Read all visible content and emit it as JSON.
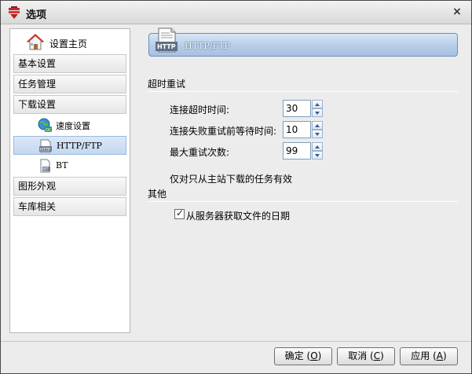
{
  "window": {
    "title": "选项"
  },
  "sidebar": {
    "home_label": "设置主页",
    "categories": [
      {
        "label": "基本设置"
      },
      {
        "label": "任务管理"
      },
      {
        "label": "下载设置"
      },
      {
        "label": "图形外观"
      },
      {
        "label": "车库相关"
      }
    ],
    "sub_items": [
      {
        "label": "速度设置",
        "icon": "speed-globe-icon"
      },
      {
        "label": "HTTP/FTP",
        "icon": "http-document-icon",
        "selected": true
      },
      {
        "label": "BT",
        "icon": "bt-document-icon"
      }
    ]
  },
  "panel": {
    "header_label": "HTTP/FTP",
    "timeout_section": "超时重试",
    "fields": [
      {
        "label": "连接超时时间:",
        "value": "30"
      },
      {
        "label": "连接失败重试前等待时间:",
        "value": "10"
      },
      {
        "label": "最大重试次数:",
        "value": "99"
      }
    ],
    "note": "仅对只从主站下载的任务有效",
    "other_section": "其他",
    "checkbox": {
      "label": "从服务器获取文件的日期",
      "checked": true
    }
  },
  "buttons": {
    "ok": {
      "label": "确定",
      "key": "O"
    },
    "cancel": {
      "label": "取消",
      "key": "C"
    },
    "apply": {
      "label": "应用",
      "key": "A"
    }
  },
  "colors": {
    "selection": "#c4d8f1",
    "header_gradient": "#b6cde8",
    "window_bg": "#ececec"
  }
}
